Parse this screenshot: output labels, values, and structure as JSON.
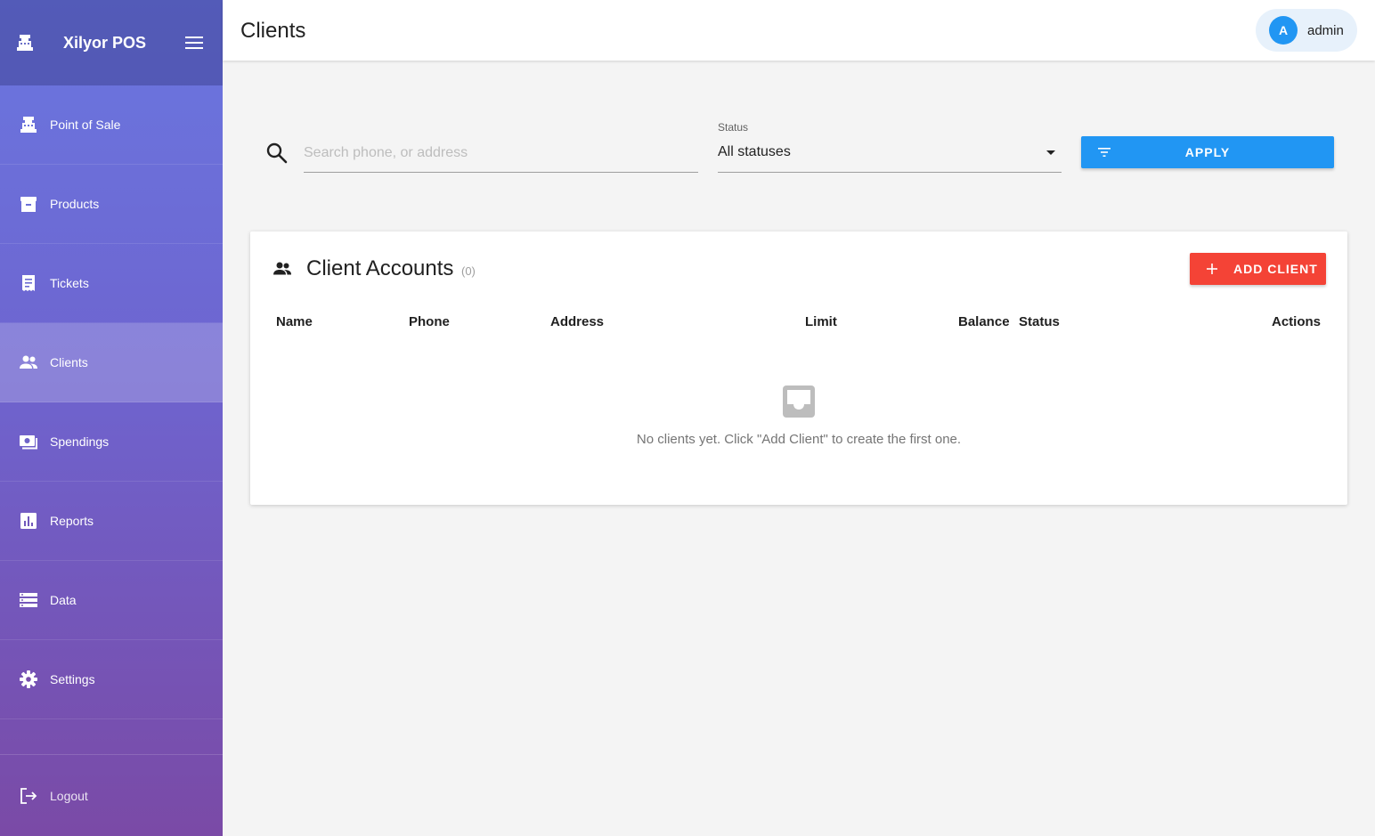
{
  "app": {
    "name": "Xilyor POS"
  },
  "sidebar": {
    "items": [
      {
        "label": "Point of Sale",
        "icon": "cash-register-icon",
        "active": false
      },
      {
        "label": "Products",
        "icon": "archive-box-icon",
        "active": false
      },
      {
        "label": "Tickets",
        "icon": "receipt-icon",
        "active": false
      },
      {
        "label": "Clients",
        "icon": "people-icon",
        "active": true
      },
      {
        "label": "Spendings",
        "icon": "money-icon",
        "active": false
      },
      {
        "label": "Reports",
        "icon": "bar-chart-icon",
        "active": false
      },
      {
        "label": "Data",
        "icon": "storage-icon",
        "active": false
      },
      {
        "label": "Settings",
        "icon": "gear-icon",
        "active": false
      }
    ],
    "logout": {
      "label": "Logout",
      "icon": "logout-icon"
    }
  },
  "header": {
    "title": "Clients",
    "user": {
      "initial": "A",
      "name": "admin"
    }
  },
  "filters": {
    "search_placeholder": "Search phone, or address",
    "search_value": "",
    "status": {
      "label": "Status",
      "value": "All statuses"
    },
    "apply_label": "APPLY"
  },
  "clients_card": {
    "title": "Client Accounts",
    "count": "(0)",
    "add_label": "ADD CLIENT",
    "columns": [
      "Name",
      "Phone",
      "Address",
      "Limit",
      "Balance",
      "Status",
      "Actions"
    ],
    "rows": [],
    "empty_message": "No clients yet. Click \"Add Client\" to create the first one."
  },
  "colors": {
    "accent_blue": "#2196f3",
    "accent_red": "#f44336",
    "sidebar_top": "#6a77e0",
    "sidebar_bottom": "#7a4aa6"
  }
}
